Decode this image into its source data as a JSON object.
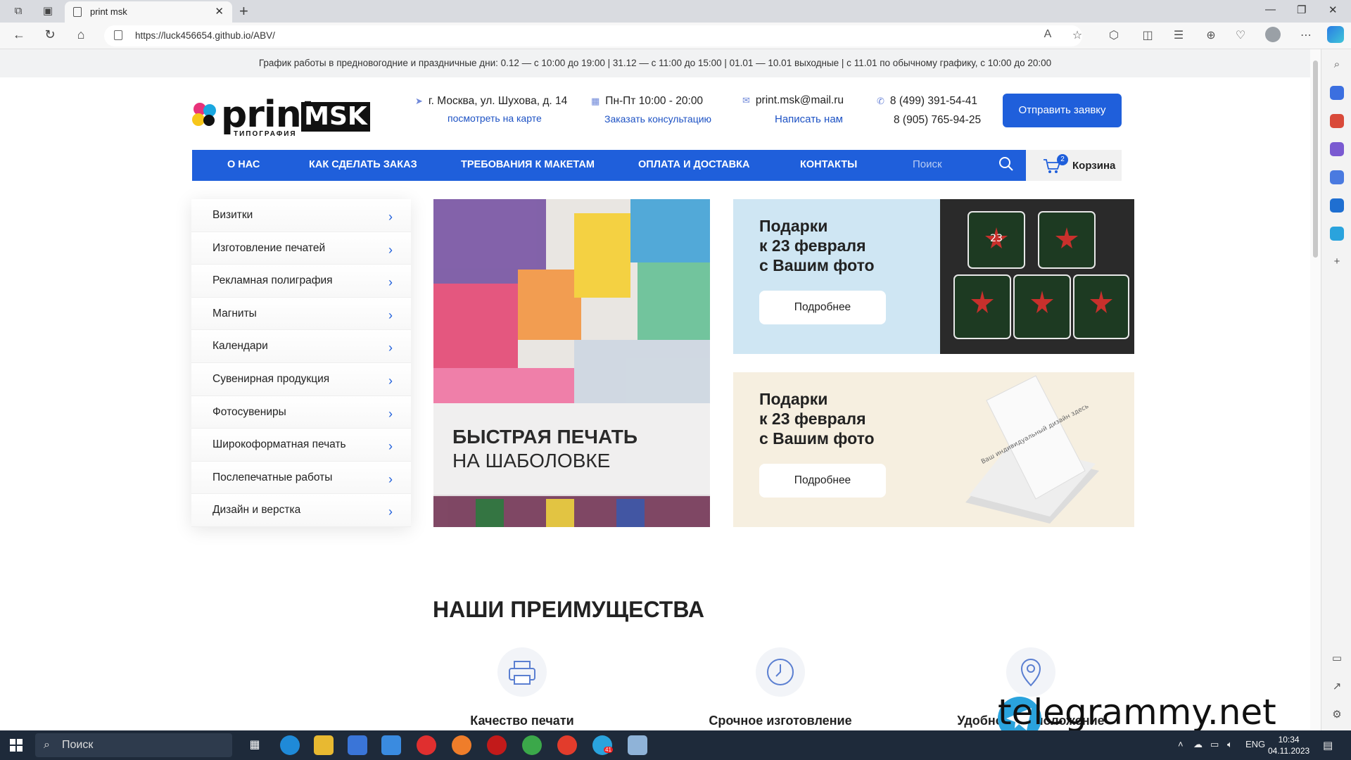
{
  "browser": {
    "tab_title": "print msk",
    "url": "https://luck456654.github.io/ABV/"
  },
  "site": {
    "notice": "График работы в предновогодние и праздничные дни: 0.12 — с 10:00 до 19:00 | 31.12 — с 11:00 до 15:00 | 01.01 — 10.01 выходные | с 11.01 по обычному графику, с 10:00 до 20:00",
    "logo": {
      "print": "print",
      "msk": "MSK",
      "subtitle": "ТИПОГРАФИЯ"
    },
    "address": "г. Москва, ул. Шухова, д. 14",
    "map_link": "посмотреть на карте",
    "hours": "Пн-Пт 10:00 - 20:00",
    "consult_link": "Заказать консультацию",
    "email": "print.msk@mail.ru",
    "write_link": "Написать нам",
    "phone1": "8 (499) 391-54-41",
    "phone2": "8 (905) 765-94-25",
    "order_button": "Отправить заявку",
    "nav": [
      "О НАС",
      "КАК СДЕЛАТЬ ЗАКАЗ",
      "ТРЕБОВАНИЯ К МАКЕТАМ",
      "ОПЛАТА И ДОСТАВКА",
      "КОНТАКТЫ"
    ],
    "search_placeholder": "Поиск",
    "cart": {
      "label": "Корзина",
      "count": "2"
    },
    "categories": [
      "Визитки",
      "Изготовление печатей",
      "Рекламная полиграфия",
      "Магниты",
      "Календари",
      "Сувенирная продукция",
      "Фотосувениры",
      "Широкоформатная печать",
      "Послепечатные работы",
      "Дизайн и верстка"
    ],
    "hero": {
      "line1": "БЫСТРАЯ ПЕЧАТЬ",
      "line2": "НА ШАБОЛОВКЕ"
    },
    "promo1": {
      "l1": "Подарки",
      "l2": "к 23 февраля",
      "l3": "с Вашим фото",
      "button": "Подробнее",
      "mug_text": "23"
    },
    "promo2": {
      "l1": "Подарки",
      "l2": "к 23 февраля",
      "l3": "с Вашим фото",
      "button": "Подробнее",
      "card_text": "Ваш индивидуальный дизайн здесь"
    },
    "advantages_title": "НАШИ ПРЕИМУЩЕСТВА",
    "advantages": [
      "Качество печати",
      "Срочное изготовление",
      "Удобное расположение"
    ]
  },
  "watermark": "telegrammy.net",
  "taskbar": {
    "search": "Поиск",
    "lang": "ENG",
    "time": "10:34",
    "date": "04.11.2023",
    "telegram_badge": "41"
  },
  "colors": {
    "brand_blue": "#1f5fdb",
    "notice_bg": "#f1f2f3"
  }
}
